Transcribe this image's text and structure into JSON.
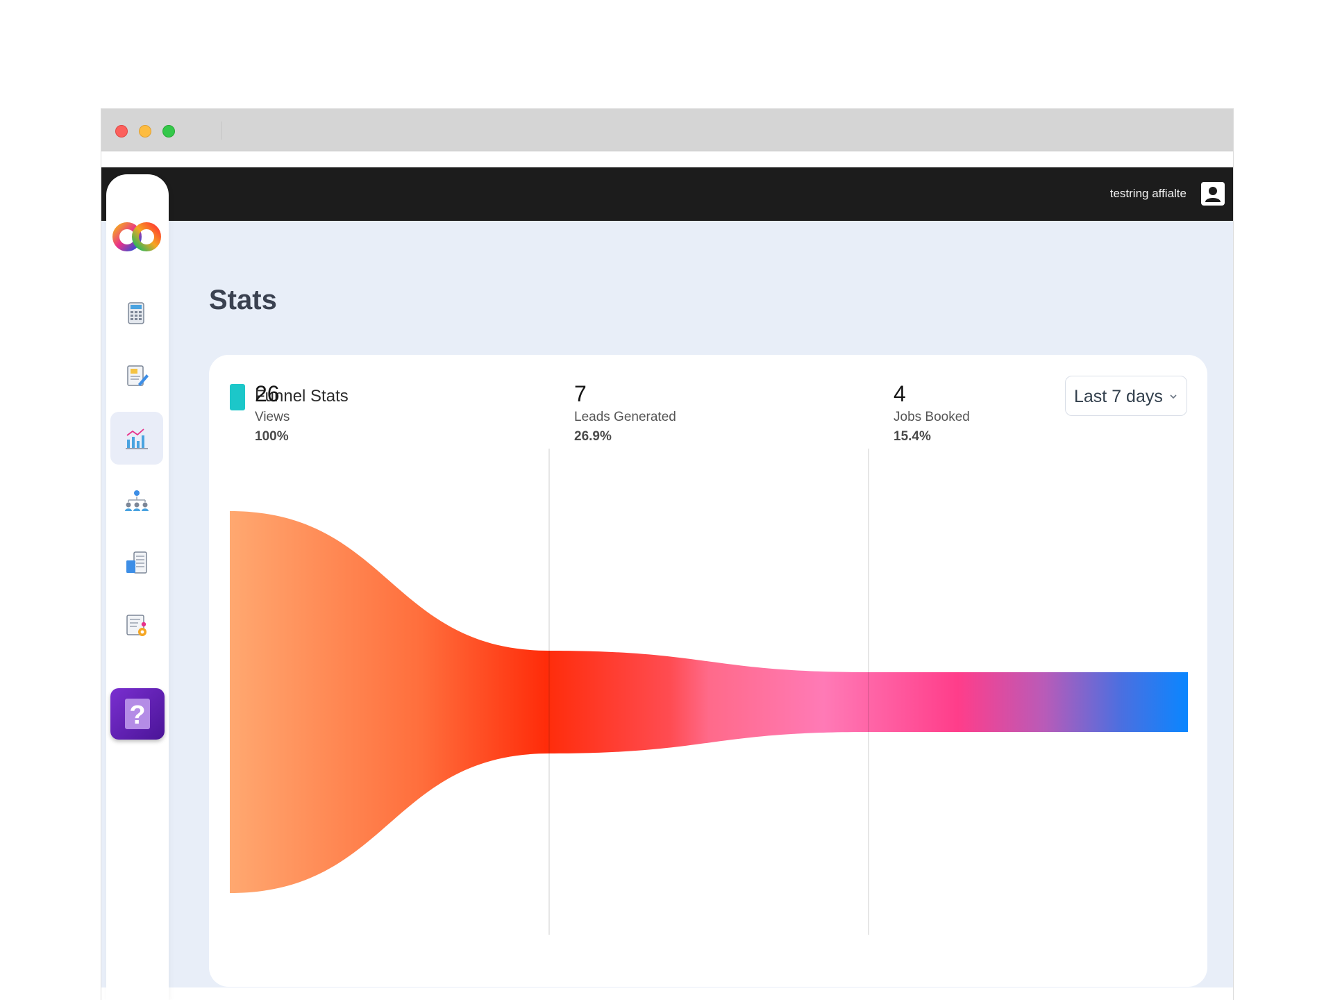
{
  "header": {
    "user_name": "testring affialte"
  },
  "page": {
    "title": "Stats"
  },
  "sidebar": {
    "items": [
      {
        "name": "calculator-icon"
      },
      {
        "name": "form-edit-icon"
      },
      {
        "name": "stats-chart-icon",
        "active": true
      },
      {
        "name": "team-network-icon"
      },
      {
        "name": "document-list-icon"
      },
      {
        "name": "settings-document-icon"
      }
    ],
    "help_label": "?"
  },
  "card": {
    "title": "Funnel Stats",
    "range_selected": "Last 7 days"
  },
  "colors": {
    "accent": "#1cc7c9",
    "help": "#5b1fb0",
    "funnel_start": "#ffa870",
    "funnel_mid": "#ff2c0a",
    "funnel_pink": "#ff7ab6",
    "funnel_end": "#0a86ff"
  },
  "chart_data": {
    "type": "funnel",
    "stages": [
      {
        "value": 26,
        "label": "Views",
        "percent": "100%"
      },
      {
        "value": 7,
        "label": "Leads Generated",
        "percent": "26.9%"
      },
      {
        "value": 4,
        "label": "Jobs Booked",
        "percent": "15.4%"
      }
    ]
  }
}
